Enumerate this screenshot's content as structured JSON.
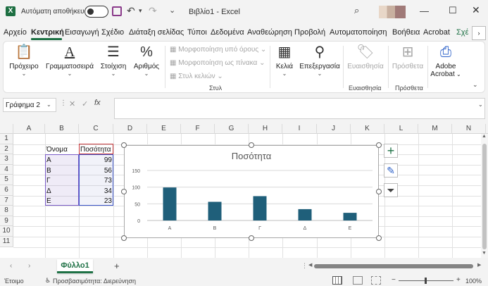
{
  "titlebar": {
    "app_icon": "X",
    "autosave_label": "Αυτόματη αποθήκευση",
    "doc_title": "Βιβλίο1 - Excel",
    "icons": [
      "excel-logo-icon",
      "save-icon",
      "undo-icon",
      "redo-icon",
      "search-icon",
      "minimize-icon",
      "maximize-icon",
      "close-icon"
    ]
  },
  "tabs": [
    "Αρχείο",
    "Κεντρική",
    "Εισαγωγή",
    "Σχέδιο",
    "Διάταξη σελίδας",
    "Τύποι",
    "Δεδομένα",
    "Αναθεώρηση",
    "Προβολή",
    "Αυτοματοποίηση",
    "Βοήθεια",
    "Acrobat",
    "Σχέ"
  ],
  "ribbon": {
    "paste": "Πρόχειρο",
    "font": "Γραμματοσειρά",
    "alignment": "Στοίχιση",
    "number": "Αριθμός",
    "cond_format": "Μορφοποίηση υπό όρους",
    "format_table": "Μορφοποίηση ως πίνακα",
    "cell_styles": "Στυλ κελιών",
    "styles_group": "Στυλ",
    "cells": "Κελιά",
    "editing": "Επεξεργασία",
    "sensitivity": "Ευαισθησία",
    "sensitivity_group": "Ευαισθησία",
    "addins": "Πρόσθετα",
    "addins_group": "Πρόσθετα",
    "acrobat_line1": "Adobe",
    "acrobat_line2": "Acrobat"
  },
  "formula_bar": {
    "name_box": "Γράφημα 2",
    "fx": "fx",
    "value": ""
  },
  "columns": [
    "A",
    "B",
    "C",
    "D",
    "E",
    "F",
    "G",
    "H",
    "I",
    "J",
    "K",
    "L",
    "M",
    "N"
  ],
  "rows": [
    "1",
    "2",
    "3",
    "4",
    "5",
    "6",
    "7",
    "8",
    "9",
    "10",
    "11"
  ],
  "table": {
    "header_name": "Όνομα",
    "header_qty": "Ποσότητα",
    "names": [
      "Α",
      "Β",
      "Γ",
      "Δ",
      "Ε"
    ],
    "values": [
      "99",
      "56",
      "73",
      "34",
      "23"
    ]
  },
  "chart_data": {
    "type": "bar",
    "title": "Ποσότητα",
    "categories": [
      "Α",
      "Β",
      "Γ",
      "Δ",
      "Ε"
    ],
    "values": [
      99,
      56,
      73,
      34,
      23
    ],
    "ylim": [
      0,
      150
    ],
    "yticks": [
      0,
      50,
      100,
      150
    ],
    "grid": true,
    "legend": "none",
    "bar_color": "#1f5f7a"
  },
  "chart_side_buttons": [
    "chart-elements-plus-icon",
    "chart-styles-brush-icon",
    "chart-filter-icon"
  ],
  "sheets": {
    "active": "Φύλλο1",
    "add": "+"
  },
  "statusbar": {
    "ready": "Έτοιμο",
    "accessibility": "Προσβασιμότητα: Διερεύνηση",
    "zoom": "100%"
  },
  "colors": {
    "excel_green": "#1e7145",
    "selection_purple": "#7a5dc7",
    "selection_blue": "#3b54c9",
    "selection_red": "#c8373b"
  }
}
